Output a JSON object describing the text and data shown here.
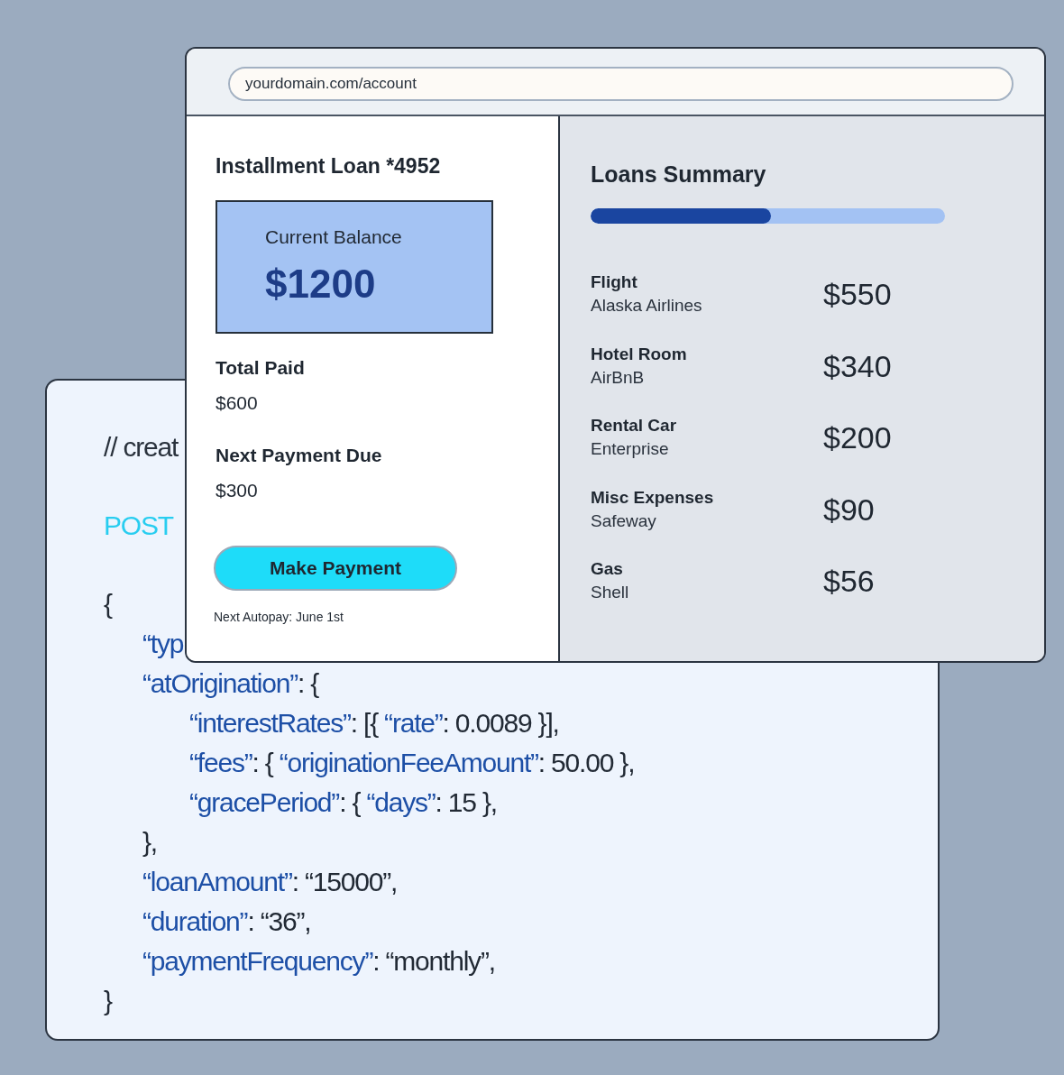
{
  "browser": {
    "address_field": {
      "value": "yourdomain.com/account"
    },
    "loan_panel": {
      "title": "Installment Loan *4952",
      "balance_card": {
        "label": "Current Balance",
        "amount": "$1200"
      },
      "stats": [
        {
          "label": "Total Paid",
          "value": "$600"
        },
        {
          "label": "Next Payment Due",
          "value": "$300"
        }
      ],
      "button": "Make Payment",
      "autopay_note": "Next Autopay: June 1st"
    },
    "summary_panel": {
      "title": "Loans Summary",
      "progress": {
        "level": 0.51
      },
      "items": [
        {
          "category": "Flight",
          "merchant": "Alaska Airlines",
          "amount": "$550"
        },
        {
          "category": "Hotel Room",
          "merchant": "AirBnB",
          "amount": "$340"
        },
        {
          "category": "Rental Car",
          "merchant": "Enterprise",
          "amount": "$200"
        },
        {
          "category": "Misc Expenses",
          "merchant": "Safeway",
          "amount": "$90"
        },
        {
          "category": "Gas",
          "merchant": "Shell",
          "amount": "$56"
        }
      ]
    }
  },
  "code_panel": {
    "blocks": [
      {
        "lines": [
          {
            "tokens": [
              {
                "kind": "comment",
                "text": "// creat"
              }
            ]
          }
        ]
      },
      {
        "lines": [
          {
            "tokens": [
              {
                "kind": "method",
                "text": "POST"
              }
            ]
          }
        ]
      },
      {
        "lines": [
          {
            "tokens": [
              {
                "kind": "plain",
                "text": "{"
              }
            ],
            "children": [
              {
                "tokens": [
                  {
                    "kind": "key",
                    "text": "“typ"
                  }
                ]
              },
              {
                "tokens": [
                  {
                    "kind": "key",
                    "text": "“atOrigination”"
                  },
                  {
                    "kind": "plain",
                    "text": ": {"
                  }
                ],
                "children": [
                  {
                    "tokens": [
                      {
                        "kind": "key",
                        "text": "“interestRates”"
                      },
                      {
                        "kind": "plain",
                        "text": ": [{ "
                      },
                      {
                        "kind": "key",
                        "text": "“rate”"
                      },
                      {
                        "kind": "plain",
                        "text": ": 0.0089 }],"
                      }
                    ]
                  },
                  {
                    "tokens": [
                      {
                        "kind": "key",
                        "text": "“fees”"
                      },
                      {
                        "kind": "plain",
                        "text": ": { "
                      },
                      {
                        "kind": "key",
                        "text": "“originationFeeAmount”"
                      },
                      {
                        "kind": "plain",
                        "text": ": 50.00 },"
                      }
                    ]
                  },
                  {
                    "tokens": [
                      {
                        "kind": "key",
                        "text": "“gracePeriod”"
                      },
                      {
                        "kind": "plain",
                        "text": ": { "
                      },
                      {
                        "kind": "key",
                        "text": "“days”"
                      },
                      {
                        "kind": "plain",
                        "text": ": 15 },"
                      }
                    ]
                  }
                ]
              },
              {
                "tokens": [
                  {
                    "kind": "plain",
                    "text": "},"
                  }
                ]
              },
              {
                "tokens": [
                  {
                    "kind": "key",
                    "text": "“loanAmount”"
                  },
                  {
                    "kind": "plain",
                    "text": ": “15000”,"
                  }
                ]
              },
              {
                "tokens": [
                  {
                    "kind": "key",
                    "text": "“duration”"
                  },
                  {
                    "kind": "plain",
                    "text": ": “36”,"
                  }
                ]
              },
              {
                "tokens": [
                  {
                    "kind": "key",
                    "text": "“paymentFrequency”"
                  },
                  {
                    "kind": "plain",
                    "text": ": “monthly”,"
                  }
                ]
              }
            ]
          },
          {
            "tokens": [
              {
                "kind": "plain",
                "text": "}"
              }
            ]
          }
        ]
      }
    ]
  }
}
